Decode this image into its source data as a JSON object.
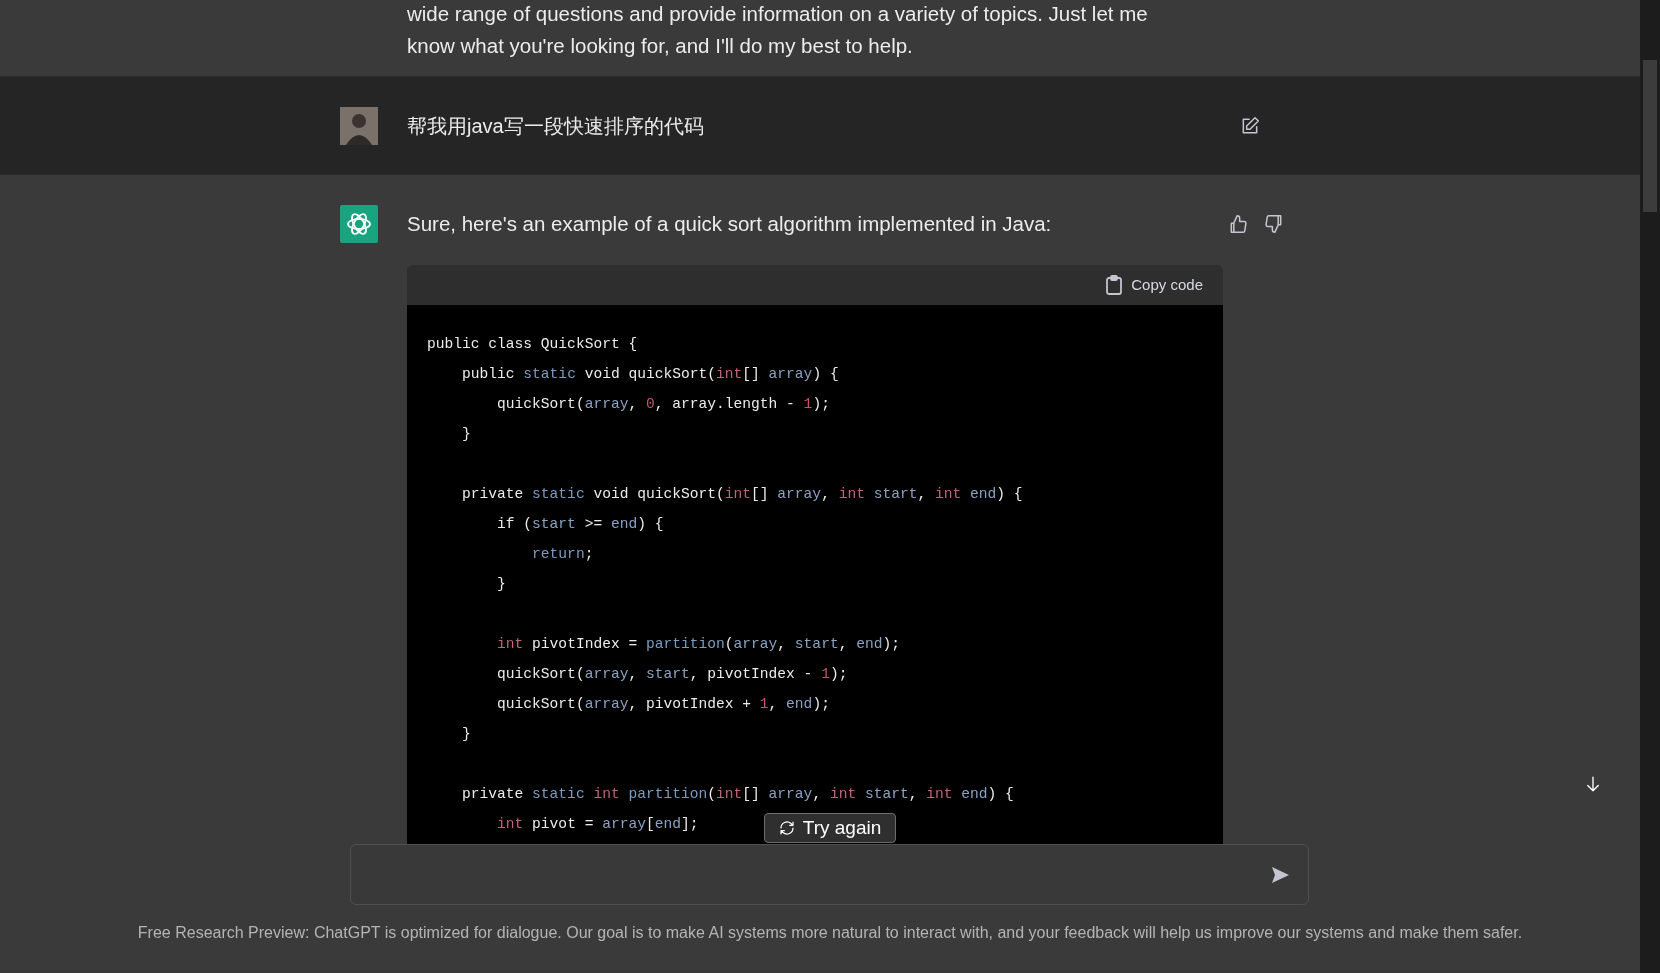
{
  "previous_reply": {
    "lines": [
      "wide range of questions and provide information on a variety of topics. Just let me",
      "know what you're looking for, and I'll do my best to help."
    ]
  },
  "user_message": {
    "text": "帮我用java写一段快速排序的代码"
  },
  "assistant_message": {
    "text": "Sure, here's an example of a quick sort algorithm implemented in Java:",
    "code_block": {
      "copy_label": "Copy code",
      "lines": [
        {
          "kind": "code",
          "tokens": [
            {
              "text": "public class QuickSort {",
              "kind": "plain"
            }
          ]
        },
        {
          "kind": "code",
          "tokens": [
            {
              "text": "    public ",
              "kind": "plain"
            },
            {
              "text": "static",
              "kind": "keyword"
            },
            {
              "text": " void quickSort(",
              "kind": "plain"
            },
            {
              "text": "int",
              "kind": "type"
            },
            {
              "text": "[] ",
              "kind": "plain"
            },
            {
              "text": "array",
              "kind": "param"
            },
            {
              "text": ") {",
              "kind": "plain"
            }
          ]
        },
        {
          "kind": "code",
          "tokens": [
            {
              "text": "        quickSort(",
              "kind": "plain"
            },
            {
              "text": "array",
              "kind": "param"
            },
            {
              "text": ", ",
              "kind": "plain"
            },
            {
              "text": "0",
              "kind": "number"
            },
            {
              "text": ", array.length - ",
              "kind": "plain"
            },
            {
              "text": "1",
              "kind": "number"
            },
            {
              "text": ");",
              "kind": "plain"
            }
          ]
        },
        {
          "kind": "code",
          "tokens": [
            {
              "text": "    }",
              "kind": "plain"
            }
          ]
        },
        {
          "kind": "blank"
        },
        {
          "kind": "code",
          "tokens": [
            {
              "text": "    private ",
              "kind": "plain"
            },
            {
              "text": "static",
              "kind": "keyword"
            },
            {
              "text": " void quickSort(",
              "kind": "plain"
            },
            {
              "text": "int",
              "kind": "type"
            },
            {
              "text": "[] ",
              "kind": "plain"
            },
            {
              "text": "array",
              "kind": "param"
            },
            {
              "text": ", ",
              "kind": "plain"
            },
            {
              "text": "int ",
              "kind": "type"
            },
            {
              "text": "start",
              "kind": "param"
            },
            {
              "text": ", ",
              "kind": "plain"
            },
            {
              "text": "int ",
              "kind": "type"
            },
            {
              "text": "end",
              "kind": "param"
            },
            {
              "text": ") {",
              "kind": "plain"
            }
          ]
        },
        {
          "kind": "code",
          "tokens": [
            {
              "text": "        if (",
              "kind": "plain"
            },
            {
              "text": "start",
              "kind": "param"
            },
            {
              "text": " >= ",
              "kind": "plain"
            },
            {
              "text": "end",
              "kind": "param"
            },
            {
              "text": ") {",
              "kind": "plain"
            }
          ]
        },
        {
          "kind": "code",
          "tokens": [
            {
              "text": "            return",
              "kind": "keyword"
            },
            {
              "text": ";",
              "kind": "plain"
            }
          ]
        },
        {
          "kind": "code",
          "tokens": [
            {
              "text": "        }",
              "kind": "plain"
            }
          ]
        },
        {
          "kind": "blank"
        },
        {
          "kind": "code",
          "tokens": [
            {
              "text": "        int",
              "kind": "type"
            },
            {
              "text": " pivotIndex = ",
              "kind": "plain"
            },
            {
              "text": "partition",
              "kind": "keyword"
            },
            {
              "text": "(",
              "kind": "plain"
            },
            {
              "text": "array",
              "kind": "param"
            },
            {
              "text": ", ",
              "kind": "plain"
            },
            {
              "text": "start",
              "kind": "param"
            },
            {
              "text": ", ",
              "kind": "plain"
            },
            {
              "text": "end",
              "kind": "param"
            },
            {
              "text": ");",
              "kind": "plain"
            }
          ]
        },
        {
          "kind": "code",
          "tokens": [
            {
              "text": "        quickSort(",
              "kind": "plain"
            },
            {
              "text": "array",
              "kind": "param"
            },
            {
              "text": ", ",
              "kind": "plain"
            },
            {
              "text": "start",
              "kind": "param"
            },
            {
              "text": ", pivotIndex - ",
              "kind": "plain"
            },
            {
              "text": "1",
              "kind": "number"
            },
            {
              "text": ");",
              "kind": "plain"
            }
          ]
        },
        {
          "kind": "code",
          "tokens": [
            {
              "text": "        quickSort(",
              "kind": "plain"
            },
            {
              "text": "array",
              "kind": "param"
            },
            {
              "text": ", pivotIndex + ",
              "kind": "plain"
            },
            {
              "text": "1",
              "kind": "number"
            },
            {
              "text": ", ",
              "kind": "plain"
            },
            {
              "text": "end",
              "kind": "param"
            },
            {
              "text": ");",
              "kind": "plain"
            }
          ]
        },
        {
          "kind": "code",
          "tokens": [
            {
              "text": "    }",
              "kind": "plain"
            }
          ]
        },
        {
          "kind": "blank"
        },
        {
          "kind": "code",
          "tokens": [
            {
              "text": "    private ",
              "kind": "plain"
            },
            {
              "text": "static ",
              "kind": "keyword"
            },
            {
              "text": "int ",
              "kind": "type"
            },
            {
              "text": "partition",
              "kind": "keyword"
            },
            {
              "text": "(",
              "kind": "plain"
            },
            {
              "text": "int",
              "kind": "type"
            },
            {
              "text": "[] ",
              "kind": "plain"
            },
            {
              "text": "array",
              "kind": "param"
            },
            {
              "text": ", ",
              "kind": "plain"
            },
            {
              "text": "int ",
              "kind": "type"
            },
            {
              "text": "start",
              "kind": "param"
            },
            {
              "text": ", ",
              "kind": "plain"
            },
            {
              "text": "int ",
              "kind": "type"
            },
            {
              "text": "end",
              "kind": "param"
            },
            {
              "text": ") {",
              "kind": "plain"
            }
          ]
        },
        {
          "kind": "code",
          "tokens": [
            {
              "text": "        int",
              "kind": "type"
            },
            {
              "text": " pivot = ",
              "kind": "plain"
            },
            {
              "text": "array",
              "kind": "param"
            },
            {
              "text": "[",
              "kind": "plain"
            },
            {
              "text": "end",
              "kind": "param"
            },
            {
              "text": "];",
              "kind": "plain"
            }
          ]
        }
      ]
    }
  },
  "try_again": {
    "label": "Try again"
  },
  "footer": {
    "text": "Free Research Preview: ChatGPT is optimized for dialogue. Our goal is to make AI systems more natural to interact with, and your feedback will help us improve our systems and make them safer."
  }
}
